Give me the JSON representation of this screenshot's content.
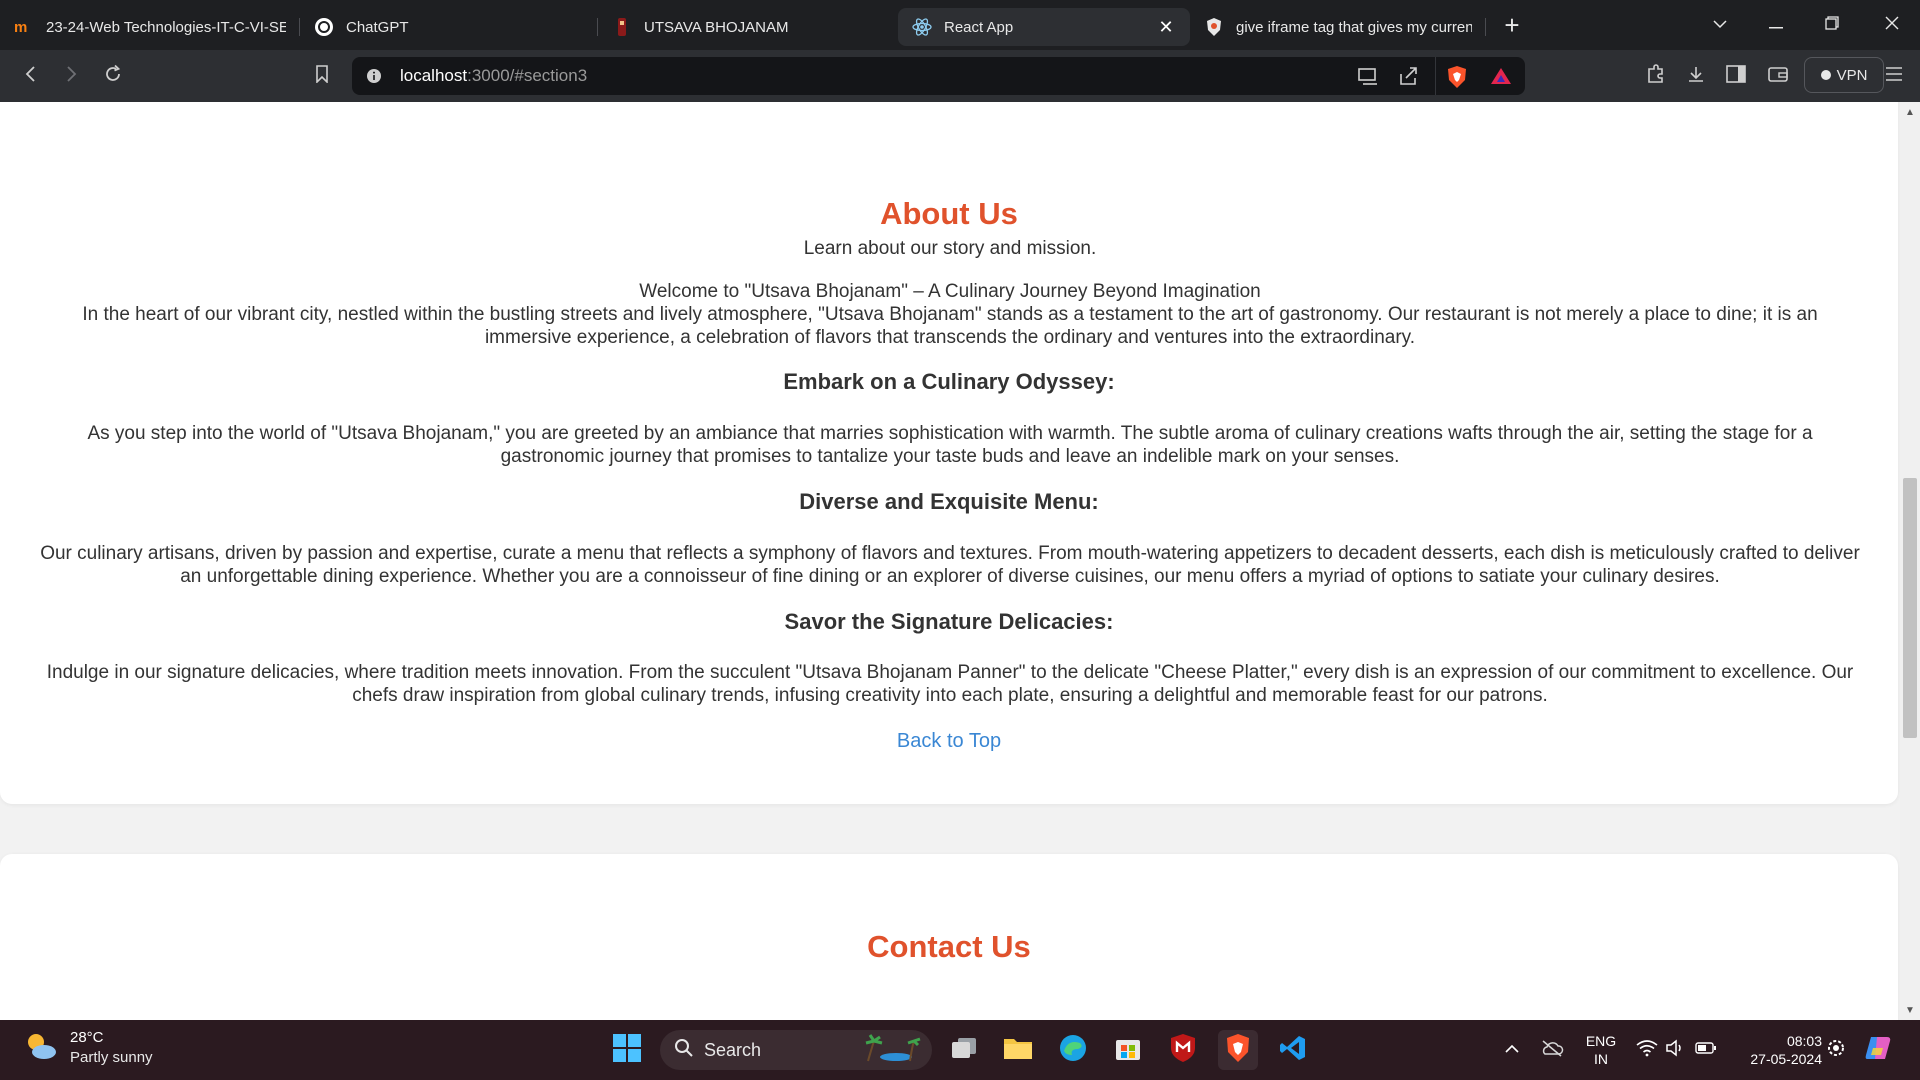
{
  "browser": {
    "tabs": [
      {
        "title": "23-24-Web Technologies-IT-C-VI-SE",
        "icon": "moodle-icon",
        "active": false
      },
      {
        "title": "ChatGPT",
        "icon": "chatgpt-icon",
        "active": false
      },
      {
        "title": "UTSAVA BHOJANAM",
        "icon": "restaurant-icon",
        "active": false
      },
      {
        "title": "React App",
        "icon": "react-icon",
        "active": true
      },
      {
        "title": "give iframe tag that gives my current",
        "icon": "brave-shield-icon",
        "active": false
      }
    ],
    "new_tab": "+",
    "url_host": "localhost",
    "url_rest": ":3000/#section3",
    "vpn_label": "VPN"
  },
  "page": {
    "about": {
      "title": "About Us",
      "subtitle": "Learn about our story and mission.",
      "welcome": "Welcome to \"Utsava Bhojanam\" – A Culinary Journey Beyond Imagination",
      "intro": "In the heart of our vibrant city, nestled within the bustling streets and lively atmosphere, \"Utsava Bhojanam\" stands as a testament to the art of gastronomy. Our restaurant is not merely a place to dine; it is an immersive experience, a celebration of flavors that transcends the ordinary and ventures into the extraordinary.",
      "sections": [
        {
          "heading": "Embark on a Culinary Odyssey:",
          "text": "As you step into the world of \"Utsava Bhojanam,\" you are greeted by an ambiance that marries sophistication with warmth. The subtle aroma of culinary creations wafts through the air, setting the stage for a gastronomic journey that promises to tantalize your taste buds and leave an indelible mark on your senses."
        },
        {
          "heading": "Diverse and Exquisite Menu:",
          "text": "Our culinary artisans, driven by passion and expertise, curate a menu that reflects a symphony of flavors and textures. From mouth-watering appetizers to decadent desserts, each dish is meticulously crafted to deliver an unforgettable dining experience. Whether you are a connoisseur of fine dining or an explorer of diverse cuisines, our menu offers a myriad of options to satiate your culinary desires."
        },
        {
          "heading": "Savor the Signature Delicacies:",
          "text": "Indulge in our signature delicacies, where tradition meets innovation. From the succulent \"Utsava Bhojanam Panner\" to the delicate \"Cheese Platter,\" every dish is an expression of our commitment to excellence. Our chefs draw inspiration from global culinary trends, infusing creativity into each plate, ensuring a delightful and memorable feast for our patrons."
        }
      ],
      "back_to_top": "Back to Top"
    },
    "contact": {
      "title": "Contact Us"
    },
    "colors": {
      "accent": "#e0522c",
      "link": "#3a87d4"
    }
  },
  "taskbar": {
    "weather_temp": "28°C",
    "weather_cond": "Partly sunny",
    "search_label": "Search",
    "lang_top": "ENG",
    "lang_bottom": "IN",
    "time": "08:03",
    "date": "27-05-2024"
  }
}
